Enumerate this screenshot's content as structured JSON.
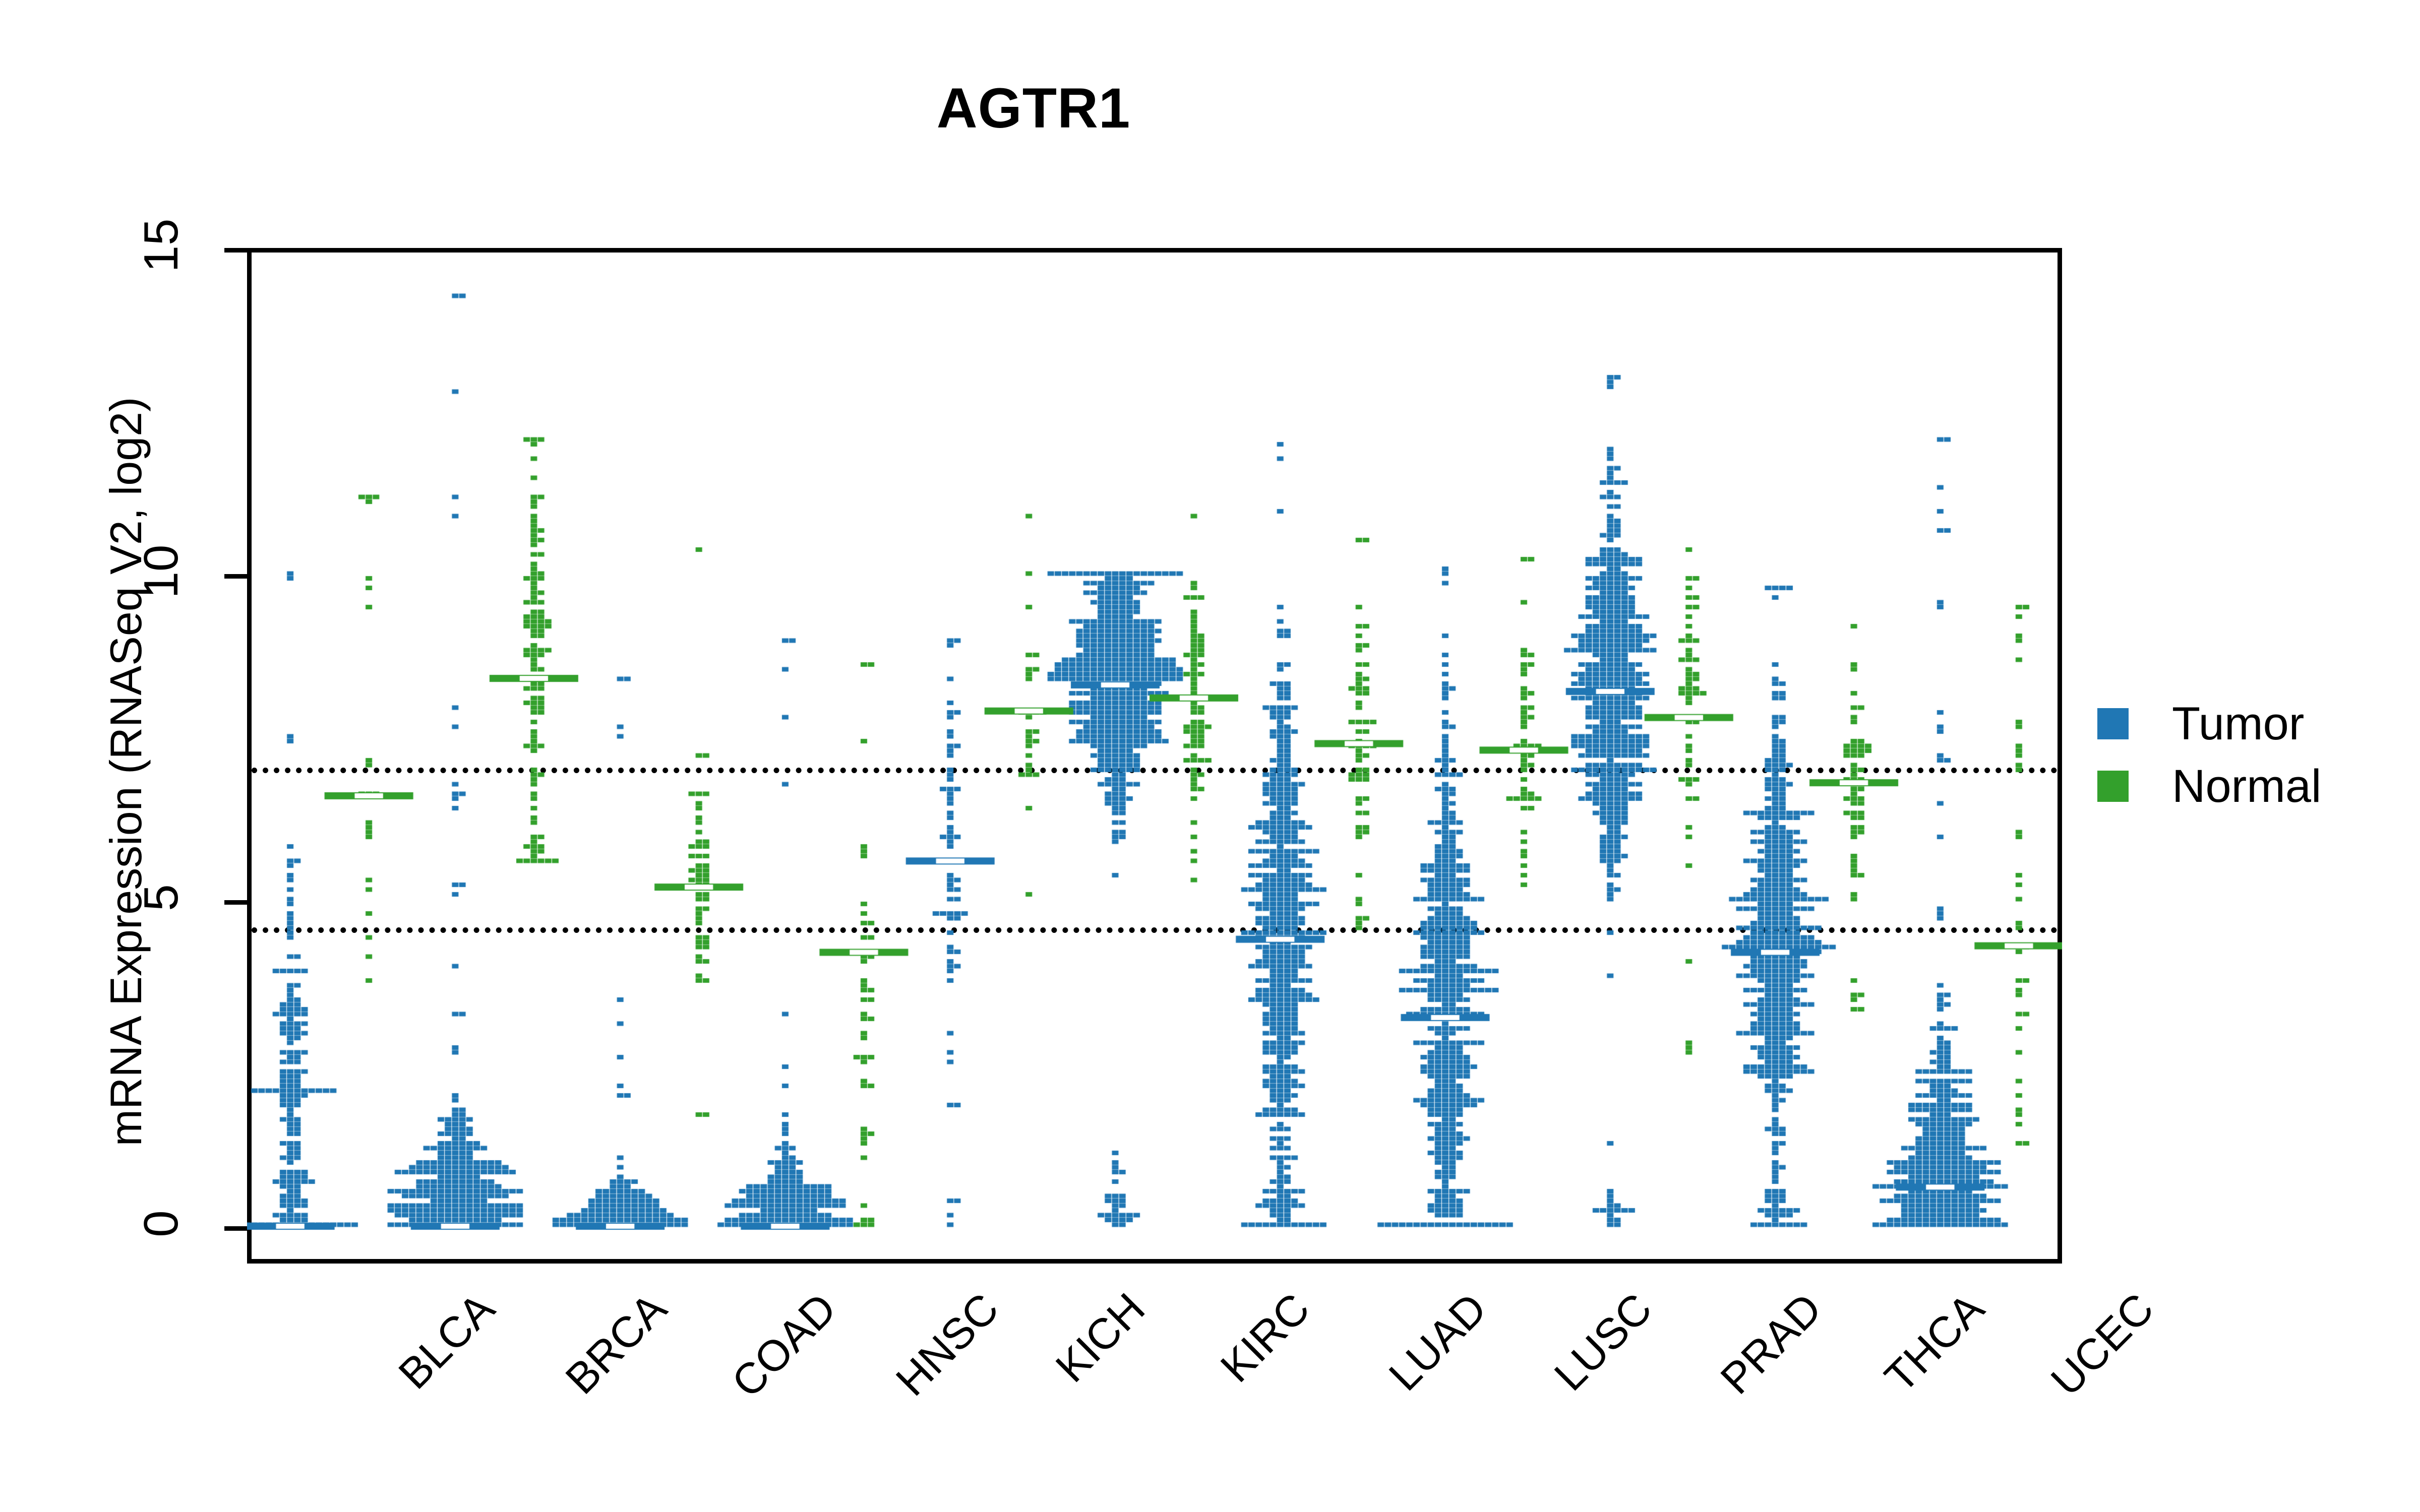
{
  "chart_data": {
    "type": "scatter",
    "plot_style": "beeswarm-violin",
    "title": "AGTR1",
    "xlabel": "",
    "ylabel": "mRNA Expression (RNASeq V2, log2)",
    "ylim": [
      -0.8,
      15
    ],
    "yticks": [
      0,
      5,
      10,
      15
    ],
    "ytick_labels": [
      "0",
      "5",
      "10",
      "15"
    ],
    "grid": false,
    "legend_position": "right",
    "reference_lines": [
      {
        "value": 7.1,
        "style": "dotted",
        "color": "#000000"
      },
      {
        "value": 4.65,
        "style": "dotted",
        "color": "#000000"
      }
    ],
    "categories": [
      "BLCA",
      "BRCA",
      "COAD",
      "HNSC",
      "KICH",
      "KIRC",
      "LUAD",
      "LUSC",
      "PRAD",
      "THCA",
      "UCEC"
    ],
    "series": [
      {
        "name": "Tumor",
        "color": "#2077b4",
        "groups": [
          {
            "category": "BLCA",
            "n": 408,
            "median": 0.0,
            "q1": 0.0,
            "q3": 2.6,
            "min": 0.0,
            "max": 10.0,
            "modes": [
              0.0,
              2.4
            ],
            "spread": "wide-bottom-heavy"
          },
          {
            "category": "BRCA",
            "n": 1100,
            "median": 0.0,
            "q1": 0.0,
            "q3": 1.4,
            "min": 0.0,
            "max": 14.3,
            "modes": [
              0.0
            ],
            "spread": "long-tail-high"
          },
          {
            "category": "COAD",
            "n": 382,
            "median": 0.0,
            "q1": 0.0,
            "q3": 0.6,
            "min": 0.0,
            "max": 8.4,
            "modes": [
              0.0
            ],
            "spread": "zero-heavy"
          },
          {
            "category": "HNSC",
            "n": 520,
            "median": 0.0,
            "q1": 0.0,
            "q3": 0.9,
            "min": 0.0,
            "max": 9.0,
            "modes": [
              0.0
            ],
            "spread": "zero-heavy"
          },
          {
            "category": "KICH",
            "n": 66,
            "median": 5.6,
            "q1": 4.3,
            "q3": 6.9,
            "min": 0.0,
            "max": 9.0,
            "modes": [
              5.6
            ],
            "spread": "mid-centered"
          },
          {
            "category": "KIRC",
            "n": 533,
            "median": 8.3,
            "q1": 7.4,
            "q3": 9.0,
            "min": 0.0,
            "max": 10.0,
            "modes": [
              8.4
            ],
            "spread": "high-centered"
          },
          {
            "category": "LUAD",
            "n": 517,
            "median": 4.4,
            "q1": 2.9,
            "q3": 6.2,
            "min": 0.0,
            "max": 12.0,
            "modes": [
              4.4
            ],
            "spread": "mid-centered"
          },
          {
            "category": "LUSC",
            "n": 501,
            "median": 3.2,
            "q1": 1.8,
            "q3": 4.9,
            "min": 0.0,
            "max": 10.1,
            "modes": [
              3.3
            ],
            "spread": "mid-low-centered"
          },
          {
            "category": "PRAD",
            "n": 498,
            "median": 8.2,
            "q1": 6.8,
            "q3": 9.3,
            "min": 0.0,
            "max": 13.0,
            "modes": [
              8.2
            ],
            "spread": "high-centered"
          },
          {
            "category": "THCA",
            "n": 513,
            "median": 4.2,
            "q1": 2.8,
            "q3": 5.3,
            "min": 0.0,
            "max": 9.8,
            "modes": [
              4.3
            ],
            "spread": "mid-centered"
          },
          {
            "category": "UCEC",
            "n": 545,
            "median": 0.6,
            "q1": 0.0,
            "q3": 2.0,
            "min": 0.0,
            "max": 12.1,
            "modes": [
              0.4
            ],
            "spread": "bottom-heavy"
          }
        ]
      },
      {
        "name": "Normal",
        "color": "#33a02c",
        "groups": [
          {
            "category": "BLCA",
            "n": 19,
            "median": 6.6,
            "q1": 5.9,
            "q3": 9.0,
            "min": 3.8,
            "max": 11.2,
            "modes": [
              6.5,
              9.1
            ],
            "spread": "bimodal"
          },
          {
            "category": "BRCA",
            "n": 112,
            "median": 8.4,
            "q1": 7.1,
            "q3": 9.4,
            "min": 5.6,
            "max": 12.1,
            "modes": [
              8.6
            ],
            "spread": "high-centered"
          },
          {
            "category": "COAD",
            "n": 51,
            "median": 5.2,
            "q1": 4.5,
            "q3": 6.0,
            "min": 1.7,
            "max": 10.4,
            "modes": [
              5.3
            ],
            "spread": "mid-centered"
          },
          {
            "category": "HNSC",
            "n": 44,
            "median": 4.2,
            "q1": 2.4,
            "q3": 5.4,
            "min": 0.0,
            "max": 8.6,
            "modes": [
              3.0
            ],
            "spread": "broad"
          },
          {
            "category": "KICH",
            "n": 25,
            "median": 7.9,
            "q1": 7.2,
            "q3": 8.6,
            "min": 5.1,
            "max": 10.9,
            "modes": [
              7.9
            ],
            "spread": "high-centered"
          },
          {
            "category": "KIRC",
            "n": 72,
            "median": 8.1,
            "q1": 7.3,
            "q3": 8.8,
            "min": 5.3,
            "max": 10.9,
            "modes": [
              8.1
            ],
            "spread": "high-centered"
          },
          {
            "category": "LUAD",
            "n": 59,
            "median": 7.4,
            "q1": 6.6,
            "q3": 8.2,
            "min": 4.6,
            "max": 10.5,
            "modes": [
              7.5
            ],
            "spread": "high-centered"
          },
          {
            "category": "LUSC",
            "n": 51,
            "median": 7.3,
            "q1": 6.6,
            "q3": 8.1,
            "min": 5.2,
            "max": 10.2,
            "modes": [
              7.3
            ],
            "spread": "high-centered"
          },
          {
            "category": "PRAD",
            "n": 52,
            "median": 7.8,
            "q1": 7.0,
            "q3": 8.5,
            "min": 2.7,
            "max": 10.4,
            "modes": [
              7.9
            ],
            "spread": "high-centered"
          },
          {
            "category": "THCA",
            "n": 59,
            "median": 6.8,
            "q1": 6.2,
            "q3": 7.4,
            "min": 3.3,
            "max": 9.2,
            "modes": [
              6.9
            ],
            "spread": "tight-high"
          },
          {
            "category": "UCEC",
            "n": 35,
            "median": 4.3,
            "q1": 3.6,
            "q3": 7.6,
            "min": 1.3,
            "max": 9.5,
            "modes": [
              4.3,
              7.8
            ],
            "spread": "bimodal"
          }
        ]
      }
    ]
  },
  "legend": {
    "items": [
      {
        "label": "Tumor",
        "color": "#2077b4"
      },
      {
        "label": "Normal",
        "color": "#33a02c"
      }
    ]
  }
}
